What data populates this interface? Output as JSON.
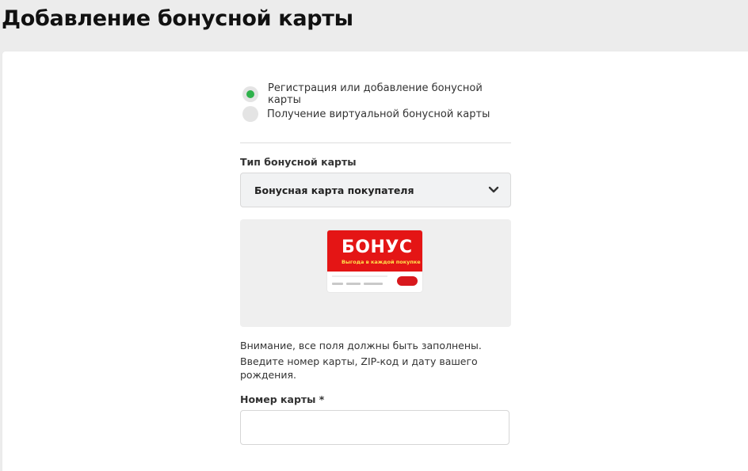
{
  "page": {
    "title": "Добавление бонусной карты"
  },
  "form": {
    "options": [
      {
        "label": "Регистрация или добавление бонусной карты",
        "selected": true
      },
      {
        "label": "Получение виртуальной бонусной карты",
        "selected": false
      }
    ],
    "card_type": {
      "label": "Тип бонусной карты",
      "value": "Бонусная карта покупателя"
    },
    "card_image": {
      "brand": "БОНУС",
      "tagline": "Выгода в каждой покупке"
    },
    "notice": {
      "line1": "Внимание, все поля должны быть заполнены.",
      "line2": "Введите номер карты, ZIP-код и дату вашего рождения."
    },
    "card_number": {
      "label": "Номер карты *",
      "value": "",
      "placeholder": ""
    }
  },
  "colors": {
    "accent": "#2fb24c",
    "card_red": "#e41515",
    "card_yellow": "#ffe34d",
    "background": "#ececec"
  },
  "icons": {
    "select_chevron": "chevron-down-icon"
  }
}
